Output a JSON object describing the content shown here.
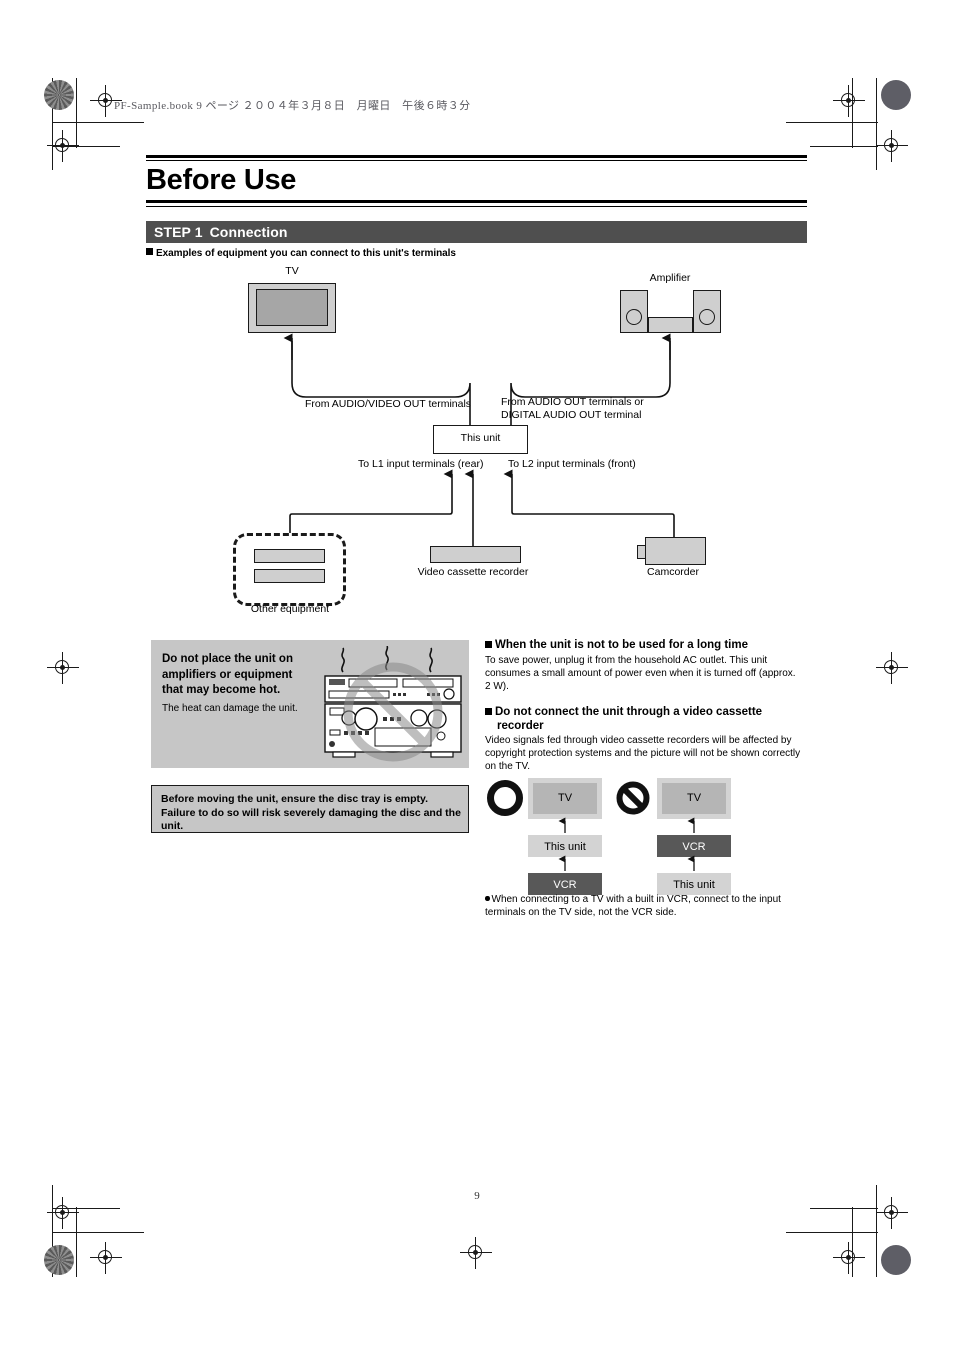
{
  "book_header": "PF-Sample.book  9 ページ  ２００４年３月８日　月曜日　午後６時３分",
  "title": "Before Use",
  "step_bar": {
    "step": "STEP 1",
    "label": "Connection"
  },
  "sub_head": "Examples of equipment you can connect to this unit's terminals",
  "connection_diagram": {
    "tv_label": "TV",
    "amplifier_label": "Amplifier",
    "from_av_out": "From AUDIO/VIDEO OUT terminals",
    "from_audio_out_line1": "From AUDIO OUT terminals or",
    "from_audio_out_line2": "DIGITAL AUDIO OUT terminal",
    "this_unit": "This unit",
    "to_l1": "To L1 input terminals (rear)",
    "to_l2": "To L2 input terminals (front)",
    "other_equipment": "Other equipment",
    "vcr": "Video cassette recorder",
    "camcorder": "Camcorder"
  },
  "caution_heat": {
    "title_line1": "Do not place the unit on",
    "title_line2": "amplifiers or equipment",
    "title_line3": "that may become hot.",
    "body": "The heat can damage the unit."
  },
  "caution_tray": {
    "line1": "Before moving the unit, ensure the disc tray is empty.",
    "line2": "Failure to do so will risk severely damaging the disc and the",
    "line3": "unit."
  },
  "long_time": {
    "heading": "When the unit is not to be used for a long time",
    "body": "To save power, unplug it from the household AC outlet. This unit consumes a small amount of power even when it is turned off (approx. 2 W)."
  },
  "no_vcr": {
    "heading_line1": "Do not connect the unit through a video cassette",
    "heading_line2": "recorder",
    "body": "Video signals fed through video cassette recorders will be affected by copyright protection systems and the picture will not be shown correctly on the TV."
  },
  "ok_ng": {
    "ok_chain": [
      "TV",
      "This unit",
      "VCR"
    ],
    "ng_chain": [
      "TV",
      "VCR",
      "This unit"
    ],
    "note": "When connecting to a TV with a built in VCR, connect to the input terminals on the TV side, not the VCR side."
  },
  "page_number": "9",
  "colors": {
    "step_bar_bg": "#4f4f4f",
    "caution_bg": "#c6c6c6",
    "device_fill": "#cfcfcf",
    "screen_fill": "#a6a6a6",
    "dark_box": "#585858"
  }
}
